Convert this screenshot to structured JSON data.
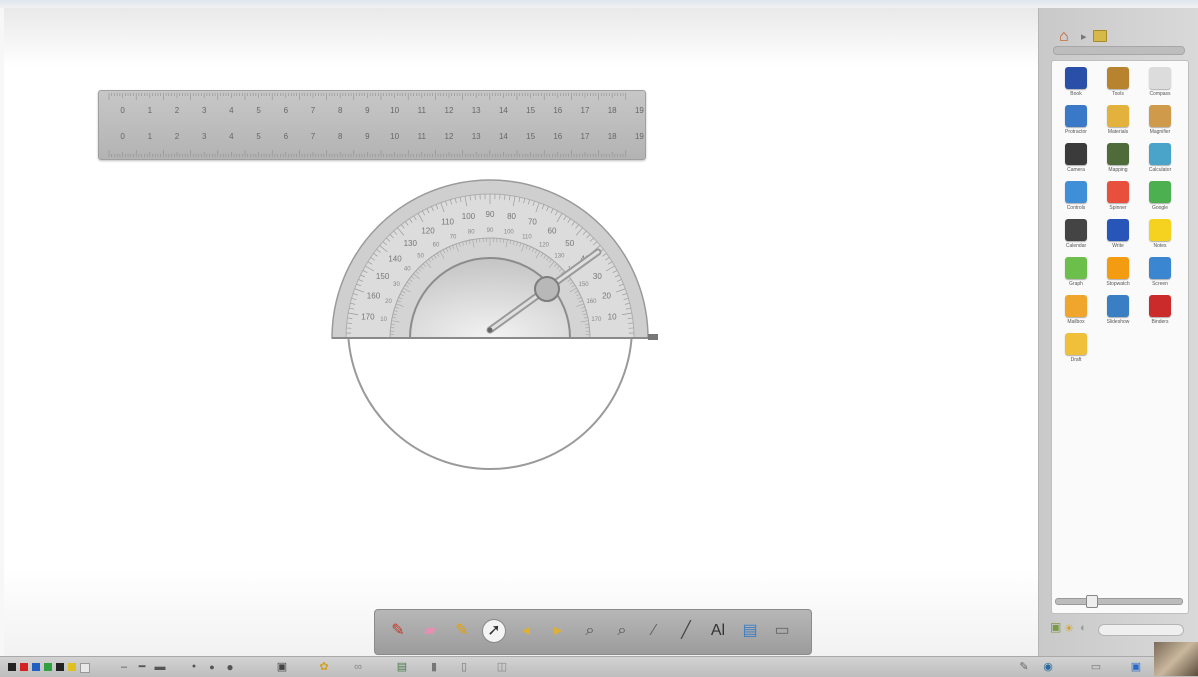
{
  "ruler": {
    "top_labels": [
      "0",
      "1",
      "2",
      "3",
      "4",
      "5",
      "6",
      "7",
      "8",
      "9",
      "10",
      "11",
      "12",
      "13",
      "14",
      "15",
      "16",
      "17",
      "18",
      "19"
    ],
    "bottom_labels": [
      "0",
      "1",
      "2",
      "3",
      "4",
      "5",
      "6",
      "7",
      "8",
      "9",
      "10",
      "11",
      "12",
      "13",
      "14",
      "15",
      "16",
      "17",
      "18",
      "19"
    ]
  },
  "protractor": {
    "outer_labels": [
      "170",
      "160",
      "150",
      "140",
      "130",
      "120",
      "110",
      "100",
      "90",
      "80",
      "70",
      "60",
      "50",
      "40",
      "30",
      "20",
      "10"
    ],
    "inner_labels": [
      "10",
      "20",
      "30",
      "40",
      "50",
      "60",
      "70",
      "80",
      "90",
      "100",
      "110",
      "120",
      "130",
      "140",
      "150",
      "160",
      "170"
    ]
  },
  "gallery": {
    "items": [
      {
        "label": "Book",
        "icon": "book-icon",
        "color": "#2a4fa8"
      },
      {
        "label": "Tools",
        "icon": "toolbox-icon",
        "color": "#b8832e"
      },
      {
        "label": "Compass",
        "icon": "compass-icon",
        "color": "#dcdcdc"
      },
      {
        "label": "Protractor",
        "icon": "protractor-icon",
        "color": "#3a78c8"
      },
      {
        "label": "Materials",
        "icon": "materials-icon",
        "color": "#e3b23c"
      },
      {
        "label": "Magnifier",
        "icon": "magnifier-icon",
        "color": "#cf9a4a"
      },
      {
        "label": "Camera",
        "icon": "camera-icon",
        "color": "#3b3b3b"
      },
      {
        "label": "Mapping",
        "icon": "map-icon",
        "color": "#4f6b3a"
      },
      {
        "label": "Calculator",
        "icon": "calculator-icon",
        "color": "#4aa3c8"
      },
      {
        "label": "Controls",
        "icon": "controls-icon",
        "color": "#3f8fd8"
      },
      {
        "label": "Spinner",
        "icon": "spinner-icon",
        "color": "#e84f3d"
      },
      {
        "label": "Google",
        "icon": "google-icon",
        "color": "#4caf50"
      },
      {
        "label": "Calendar",
        "icon": "calendar-icon",
        "color": "#444444"
      },
      {
        "label": "Write",
        "icon": "pen-icon",
        "color": "#2756b8"
      },
      {
        "label": "Notes",
        "icon": "notes-icon",
        "color": "#f4d21f"
      },
      {
        "label": "Graph",
        "icon": "graph-icon",
        "color": "#6cbf4a"
      },
      {
        "label": "Stopwatch",
        "icon": "stopwatch-icon",
        "color": "#f39c12"
      },
      {
        "label": "Screen",
        "icon": "screen-icon",
        "color": "#3a86d0"
      },
      {
        "label": "Mailbox",
        "icon": "mailbox-icon",
        "color": "#f0a52c"
      },
      {
        "label": "Slideshow",
        "icon": "slideshow-icon",
        "color": "#3a7fc4"
      },
      {
        "label": "Binders",
        "icon": "binder-icon",
        "color": "#cc2b2b"
      },
      {
        "label": "Draft",
        "icon": "clock-icon",
        "color": "#f0c03a"
      }
    ]
  },
  "toolbar": {
    "tools": [
      {
        "name": "red-pen-tool",
        "glyph": "✎",
        "color": "#c0392b"
      },
      {
        "name": "eraser-tool",
        "glyph": "▰",
        "color": "#e58fb2"
      },
      {
        "name": "highlighter-tool",
        "glyph": "✎",
        "color": "#e6a000"
      },
      {
        "name": "pointer-tool",
        "glyph": "➚",
        "color": "#333333"
      },
      {
        "name": "undo-tool",
        "glyph": "◂",
        "color": "#e0b030"
      },
      {
        "name": "redo-tool",
        "glyph": "▸",
        "color": "#e0b030"
      },
      {
        "name": "zoom-in-tool",
        "glyph": "⌕",
        "color": "#555555"
      },
      {
        "name": "zoom-out-tool",
        "glyph": "⌕",
        "color": "#555555"
      },
      {
        "name": "magic-pen-tool",
        "glyph": "⁄",
        "color": "#666666"
      },
      {
        "name": "line-tool",
        "glyph": "╱",
        "color": "#444444"
      },
      {
        "name": "text-tool",
        "glyph": "Al",
        "color": "#333333"
      },
      {
        "name": "shape-tool",
        "glyph": "▤",
        "color": "#3a7fc4"
      },
      {
        "name": "keyboard-tool",
        "glyph": "▭",
        "color": "#666666"
      }
    ]
  },
  "colors": {
    "accent_red": "#d42020",
    "accent_blue": "#2060c0",
    "accent_green": "#30a040",
    "accent_yellow": "#e0c020",
    "protractor_grey": "#c8c8c8"
  }
}
